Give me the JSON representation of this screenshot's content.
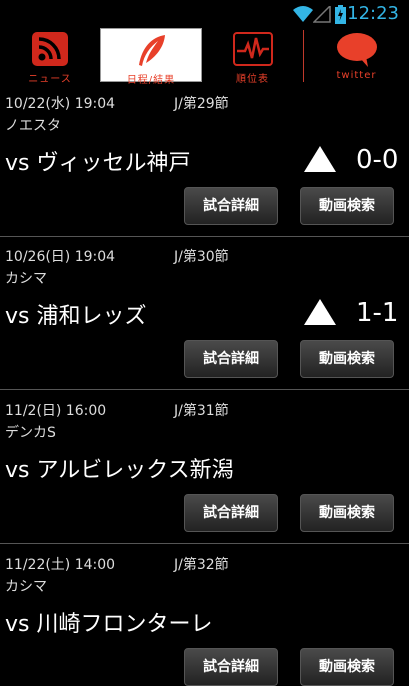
{
  "status": {
    "time": "12:23"
  },
  "tabs": [
    {
      "label": "ニュース"
    },
    {
      "label": "日程/結果"
    },
    {
      "label": "順位表"
    },
    {
      "label": "twitter"
    }
  ],
  "buttons": {
    "detail": "試合詳細",
    "video": "動画検索"
  },
  "matches": [
    {
      "date": "10/22(水) 19:04",
      "round": "J/第29節",
      "venue": "ノエスタ",
      "opponent": "vs ヴィッセル神戸",
      "score": "0-0",
      "has_result": true
    },
    {
      "date": "10/26(日) 19:04",
      "round": "J/第30節",
      "venue": "カシマ",
      "opponent": "vs 浦和レッズ",
      "score": "1-1",
      "has_result": true
    },
    {
      "date": "11/2(日) 16:00",
      "round": "J/第31節",
      "venue": "デンカS",
      "opponent": "vs アルビレックス新潟",
      "score": "",
      "has_result": false
    },
    {
      "date": "11/22(土) 14:00",
      "round": "J/第32節",
      "venue": "カシマ",
      "opponent": "vs 川崎フロンターレ",
      "score": "",
      "has_result": false
    }
  ],
  "colors": {
    "accent": "#e8402a",
    "status_blue": "#33b5e5"
  }
}
